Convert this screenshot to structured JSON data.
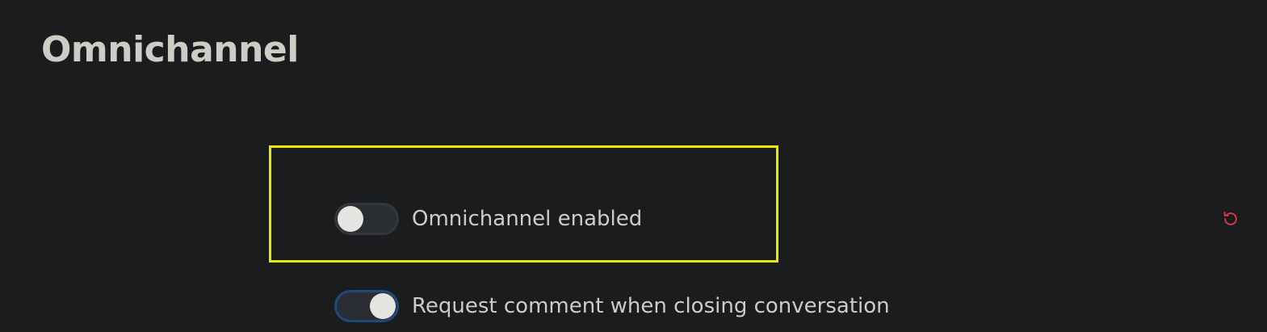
{
  "header": {
    "title": "Omnichannel"
  },
  "settings": [
    {
      "label": "Omnichannel enabled",
      "enabled": false
    },
    {
      "label": "Request comment when closing conversation",
      "enabled": true
    }
  ],
  "icons": {
    "reset": "reset-icon"
  },
  "colors": {
    "background": "#1b1c1e",
    "text": "#cfccc6",
    "highlight": "#e9e800",
    "reset_icon": "#e5364a",
    "toggle_on_border": "#1d4a7c"
  }
}
